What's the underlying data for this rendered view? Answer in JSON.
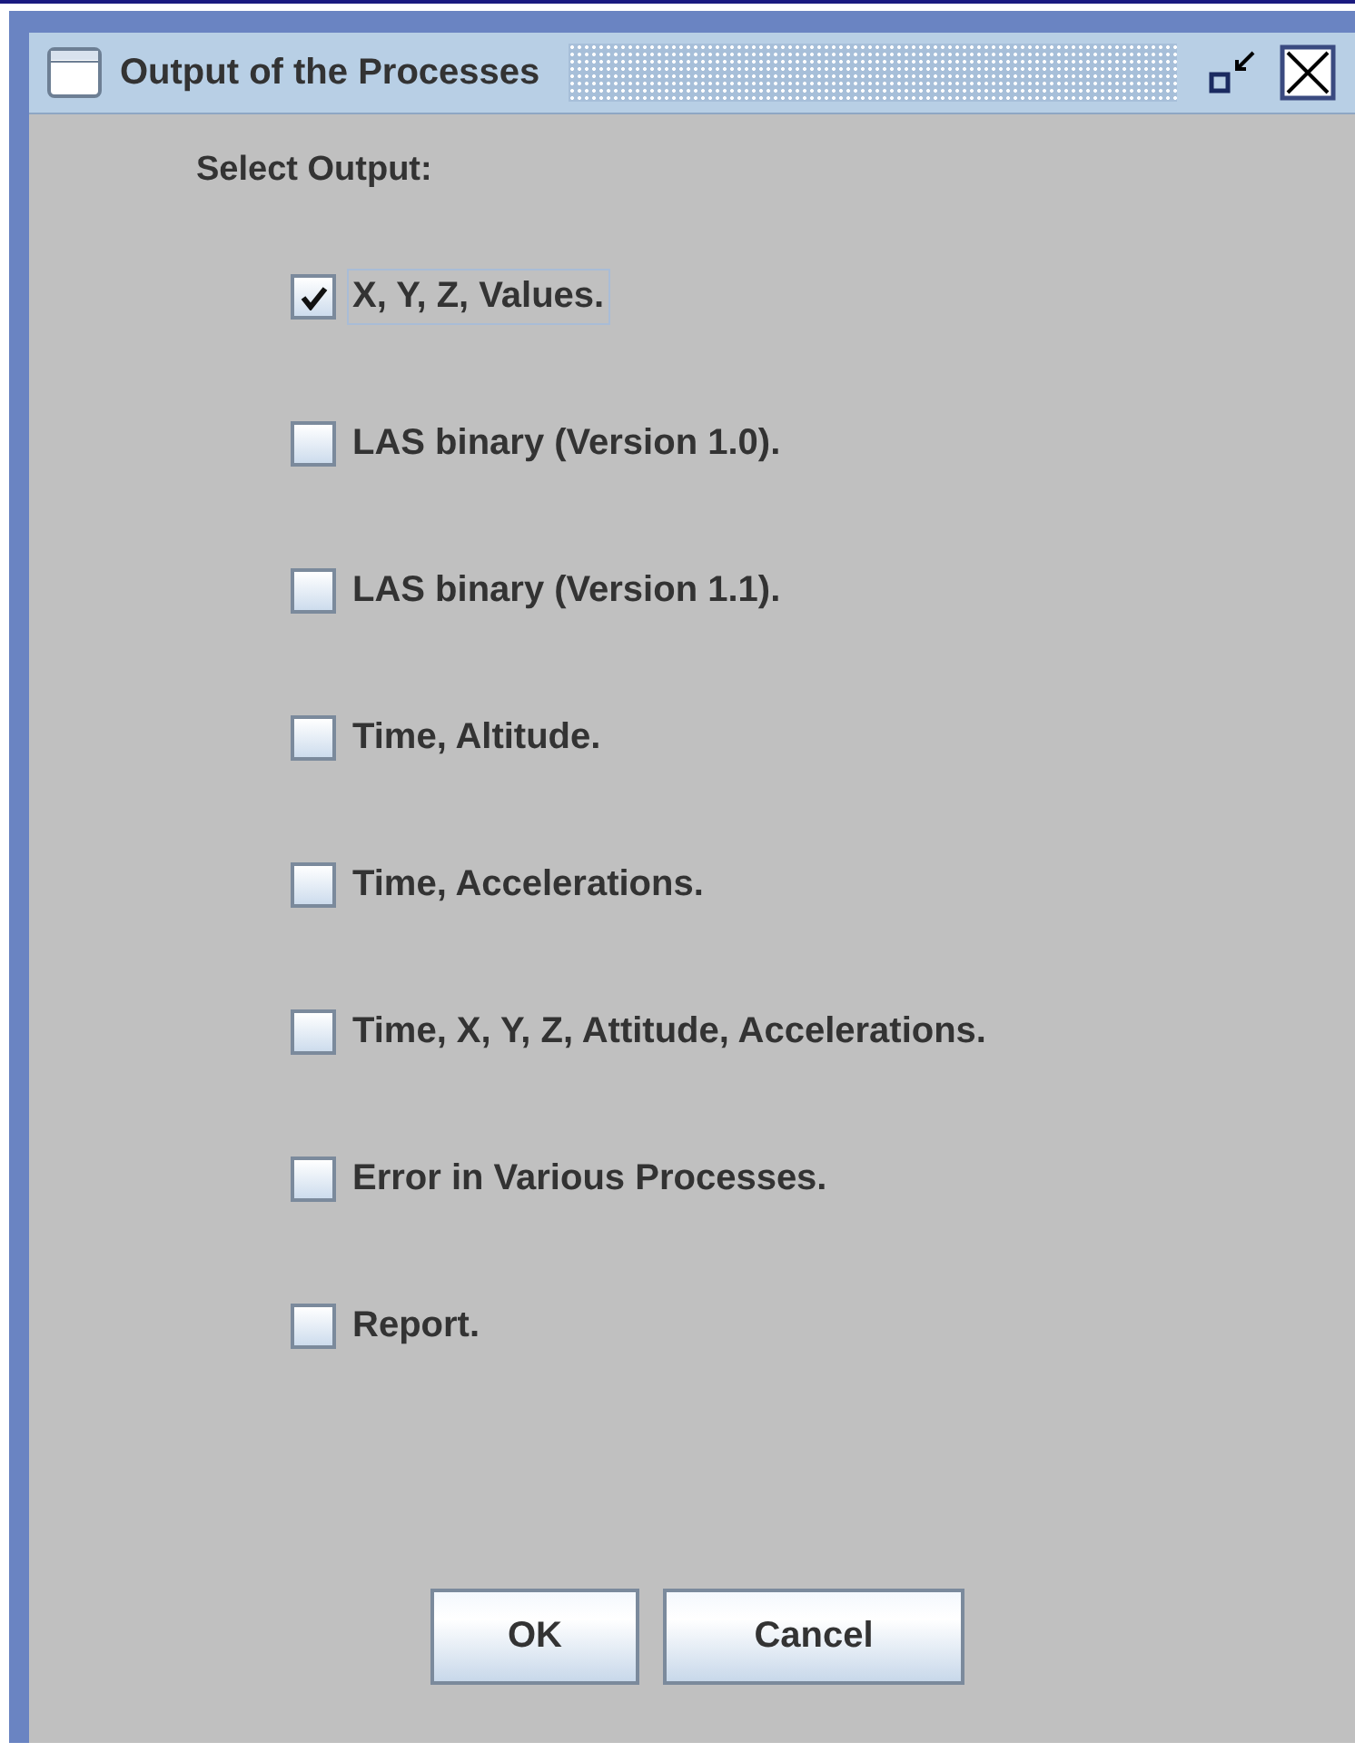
{
  "window": {
    "title": "Output of the Processes"
  },
  "heading": "Select Output:",
  "options": [
    {
      "label": "X, Y, Z, Values.",
      "checked": true,
      "focused": true
    },
    {
      "label": "LAS binary (Version 1.0).",
      "checked": false,
      "focused": false
    },
    {
      "label": "LAS binary (Version 1.1).",
      "checked": false,
      "focused": false
    },
    {
      "label": "Time, Altitude.",
      "checked": false,
      "focused": false
    },
    {
      "label": "Time, Accelerations.",
      "checked": false,
      "focused": false
    },
    {
      "label": "Time, X, Y, Z, Attitude, Accelerations.",
      "checked": false,
      "focused": false
    },
    {
      "label": "Error in Various Processes.",
      "checked": false,
      "focused": false
    },
    {
      "label": "Report.",
      "checked": false,
      "focused": false
    }
  ],
  "buttons": [
    "OK",
    "Cancel"
  ]
}
